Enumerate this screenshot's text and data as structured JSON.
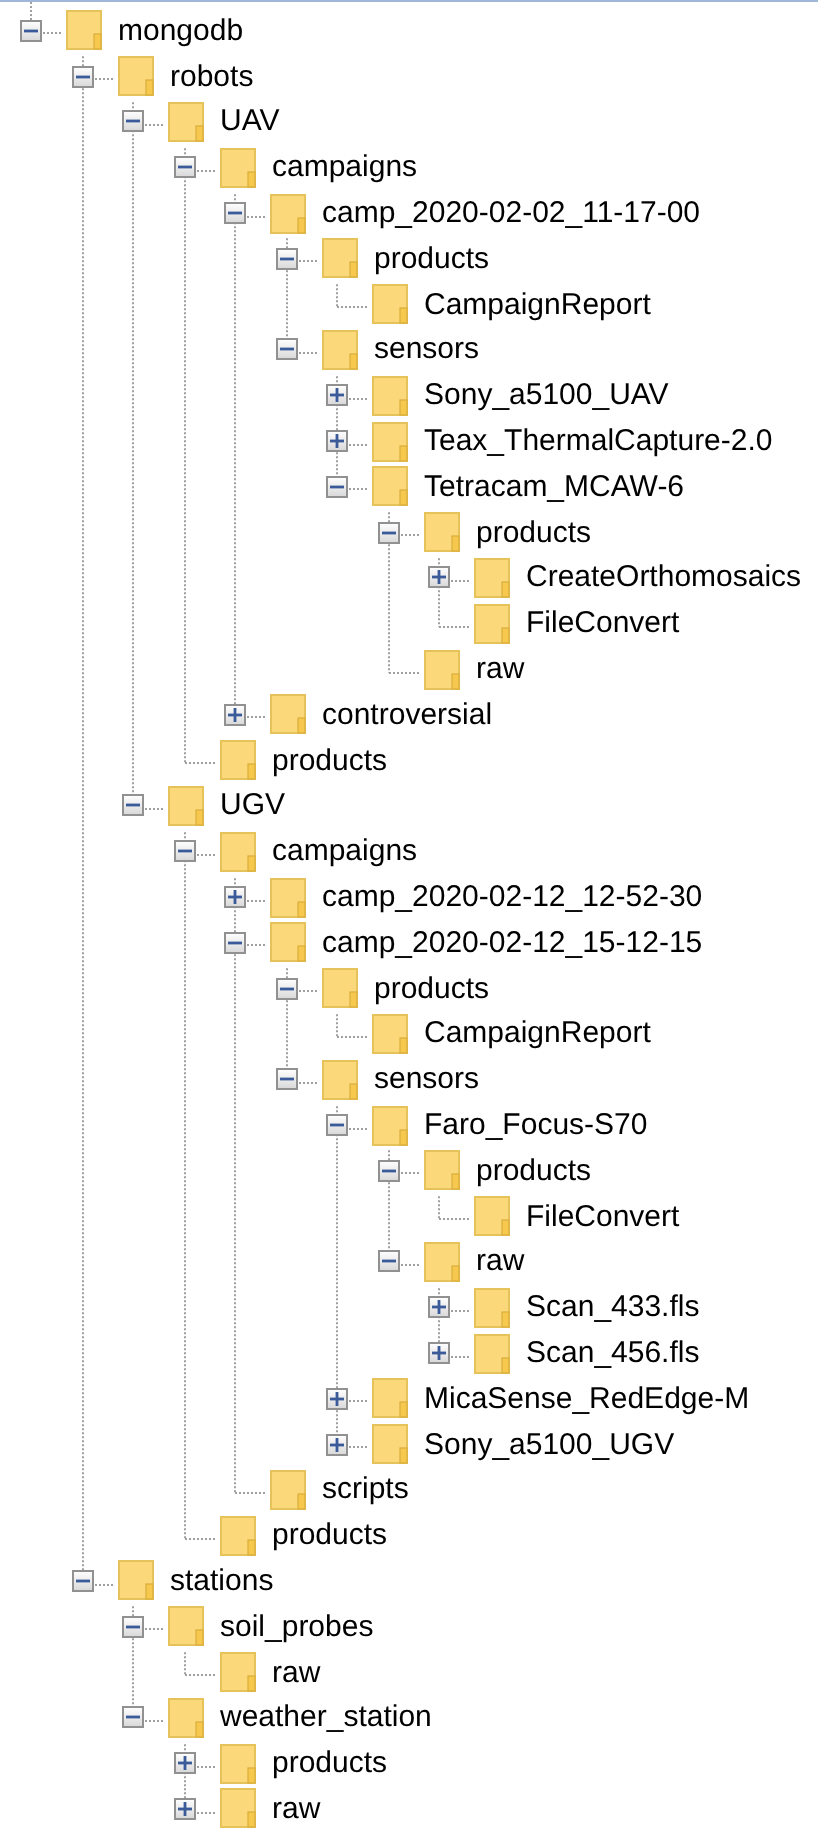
{
  "tree": [
    {
      "label": "mongodb",
      "expanded": true,
      "children": [
        {
          "label": "robots",
          "expanded": true,
          "children": [
            {
              "label": "UAV",
              "expanded": true,
              "children": [
                {
                  "label": "campaigns",
                  "expanded": true,
                  "children": [
                    {
                      "label": "camp_2020-02-02_11-17-00",
                      "expanded": true,
                      "children": [
                        {
                          "label": "products",
                          "expanded": true,
                          "children": [
                            {
                              "label": "CampaignReport"
                            }
                          ]
                        },
                        {
                          "label": "sensors",
                          "expanded": true,
                          "children": [
                            {
                              "label": "Sony_a5100_UAV",
                              "expanded": false
                            },
                            {
                              "label": "Teax_ThermalCapture-2.0",
                              "expanded": false
                            },
                            {
                              "label": "Tetracam_MCAW-6",
                              "expanded": true,
                              "children": [
                                {
                                  "label": "products",
                                  "expanded": true,
                                  "children": [
                                    {
                                      "label": "CreateOrthomosaics",
                                      "expanded": false
                                    },
                                    {
                                      "label": "FileConvert"
                                    }
                                  ]
                                },
                                {
                                  "label": "raw"
                                }
                              ]
                            }
                          ]
                        }
                      ]
                    },
                    {
                      "label": "controversial",
                      "expanded": false
                    }
                  ]
                },
                {
                  "label": "products"
                }
              ]
            },
            {
              "label": "UGV",
              "expanded": true,
              "children": [
                {
                  "label": "campaigns",
                  "expanded": true,
                  "children": [
                    {
                      "label": "camp_2020-02-12_12-52-30",
                      "expanded": false
                    },
                    {
                      "label": "camp_2020-02-12_15-12-15",
                      "expanded": true,
                      "children": [
                        {
                          "label": "products",
                          "expanded": true,
                          "children": [
                            {
                              "label": "CampaignReport"
                            }
                          ]
                        },
                        {
                          "label": "sensors",
                          "expanded": true,
                          "children": [
                            {
                              "label": "Faro_Focus-S70",
                              "expanded": true,
                              "children": [
                                {
                                  "label": "products",
                                  "expanded": true,
                                  "children": [
                                    {
                                      "label": "FileConvert"
                                    }
                                  ]
                                },
                                {
                                  "label": "raw",
                                  "expanded": true,
                                  "children": [
                                    {
                                      "label": "Scan_433.fls",
                                      "expanded": false
                                    },
                                    {
                                      "label": "Scan_456.fls",
                                      "expanded": false
                                    }
                                  ]
                                }
                              ]
                            },
                            {
                              "label": "MicaSense_RedEdge-M",
                              "expanded": false
                            },
                            {
                              "label": "Sony_a5100_UGV",
                              "expanded": false
                            }
                          ]
                        }
                      ]
                    },
                    {
                      "label": "scripts"
                    }
                  ]
                },
                {
                  "label": "products"
                }
              ]
            }
          ]
        },
        {
          "label": "stations",
          "expanded": true,
          "children": [
            {
              "label": "soil_probes",
              "expanded": true,
              "children": [
                {
                  "label": "raw"
                }
              ]
            },
            {
              "label": "weather_station",
              "expanded": true,
              "children": [
                {
                  "label": "products",
                  "expanded": false
                },
                {
                  "label": "raw",
                  "expanded": false
                }
              ]
            }
          ]
        }
      ]
    }
  ]
}
